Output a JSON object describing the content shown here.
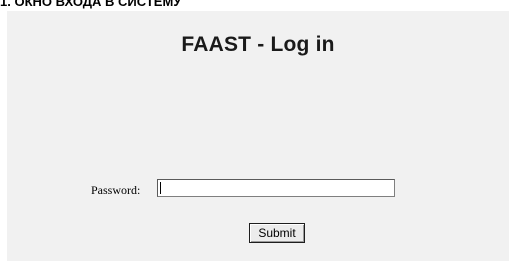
{
  "document": {
    "heading": "1. ОКНО ВХОДА В СИСТЕМУ"
  },
  "login": {
    "title": "FAAST - Log in",
    "password_label": "Password:",
    "password_value": "",
    "submit_label": "Submit"
  },
  "colors": {
    "panel_background": "#f1f1f1",
    "page_background": "#ffffff"
  }
}
